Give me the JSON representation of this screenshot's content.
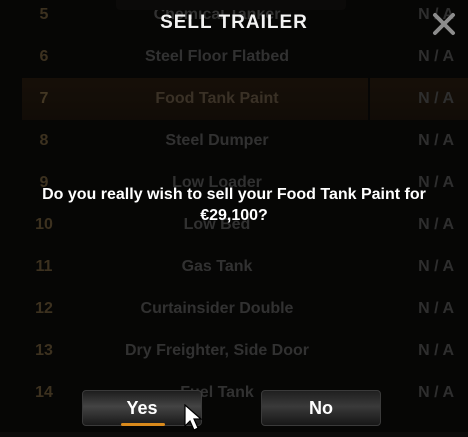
{
  "dialog": {
    "title": "SELL TRAILER",
    "message": "Do you really wish to sell your Food Tank Paint for €29,100?",
    "yes_label": "Yes",
    "no_label": "No"
  },
  "background_list": {
    "rows": [
      {
        "num": "5",
        "name": "Chemical Tanker",
        "value": "N / A"
      },
      {
        "num": "6",
        "name": "Steel Floor Flatbed",
        "value": "N / A"
      },
      {
        "num": "7",
        "name": "Food Tank Paint",
        "value": "N / A",
        "selected": true
      },
      {
        "num": "8",
        "name": "Steel Dumper",
        "value": "N / A"
      },
      {
        "num": "9",
        "name": "Low Loader",
        "value": "N / A"
      },
      {
        "num": "10",
        "name": "Low Bed",
        "value": "N / A"
      },
      {
        "num": "11",
        "name": "Gas Tank",
        "value": "N / A"
      },
      {
        "num": "12",
        "name": "Curtainsider Double",
        "value": "N / A"
      },
      {
        "num": "13",
        "name": "Dry Freighter, Side Door",
        "value": "N / A"
      },
      {
        "num": "14",
        "name": "Fuel Tank",
        "value": "N / A"
      }
    ]
  },
  "colors": {
    "accent": "#d98a1c",
    "background": "#0c0b0a"
  },
  "icons": {
    "close": "close-icon",
    "cursor": "mouse-cursor-icon"
  }
}
